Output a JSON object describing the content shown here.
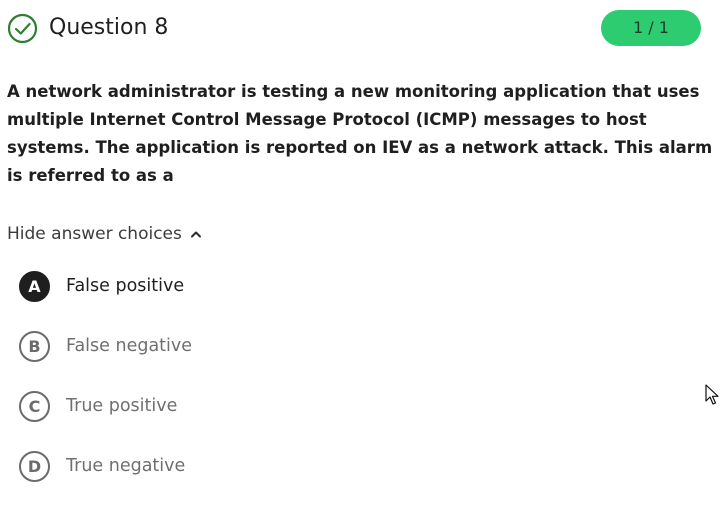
{
  "question": {
    "title": "Question 8",
    "score": "1 / 1",
    "status_icon": "check-circle-icon",
    "text": "A network administrator is testing a new monitoring application that uses multiple Internet Control Message Protocol (ICMP) messages to host systems. The application is reported on IEV as a network attack. This alarm is referred to as a"
  },
  "answers": {
    "toggle_label": "Hide answer choices",
    "toggle_icon": "chevron-up-icon",
    "choices": [
      {
        "letter": "A",
        "label": "False positive",
        "selected": true
      },
      {
        "letter": "B",
        "label": "False negative",
        "selected": false
      },
      {
        "letter": "C",
        "label": "True positive",
        "selected": false
      },
      {
        "letter": "D",
        "label": "True negative",
        "selected": false
      }
    ]
  },
  "colors": {
    "correct_green": "#2e7d32",
    "badge_green": "#2ecc71",
    "selected_dark": "#1f1f1f",
    "muted_gray": "#6b6b6b"
  }
}
